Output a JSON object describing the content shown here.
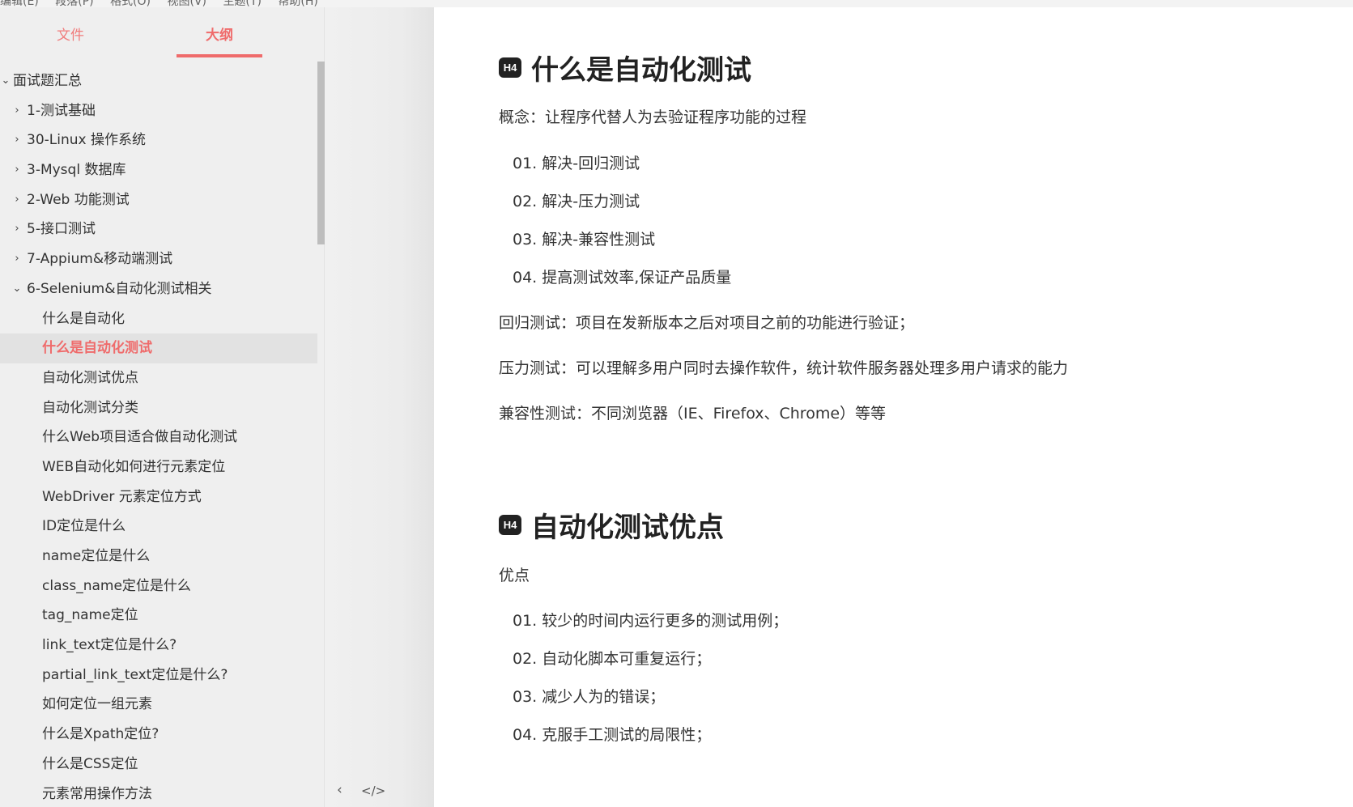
{
  "menubar": {
    "items": [
      "编辑(E)",
      "段落(P)",
      "格式(O)",
      "视图(V)",
      "主题(T)",
      "帮助(H)"
    ]
  },
  "sidebar": {
    "tabs": [
      {
        "label": "文件",
        "active": false
      },
      {
        "label": "大纲",
        "active": true
      }
    ],
    "outline": [
      {
        "label": "面试题汇总",
        "level": 0,
        "expanded": true
      },
      {
        "label": "1-测试基础",
        "level": 1,
        "expanded": false
      },
      {
        "label": "30-Linux 操作系统",
        "level": 1,
        "expanded": false
      },
      {
        "label": "3-Mysql 数据库",
        "level": 1,
        "expanded": false
      },
      {
        "label": "2-Web 功能测试",
        "level": 1,
        "expanded": false
      },
      {
        "label": "5-接口测试",
        "level": 1,
        "expanded": false
      },
      {
        "label": "7-Appium&移动端测试",
        "level": 1,
        "expanded": false
      },
      {
        "label": "6-Selenium&自动化测试相关",
        "level": 1,
        "expanded": true
      },
      {
        "label": "什么是自动化",
        "level": 2
      },
      {
        "label": "什么是自动化测试",
        "level": 2,
        "active": true
      },
      {
        "label": "自动化测试优点",
        "level": 2
      },
      {
        "label": "自动化测试分类",
        "level": 2
      },
      {
        "label": "什么Web项目适合做自动化测试",
        "level": 2
      },
      {
        "label": "WEB自动化如何进行元素定位",
        "level": 2
      },
      {
        "label": "WebDriver 元素定位方式",
        "level": 2
      },
      {
        "label": "ID定位是什么",
        "level": 2
      },
      {
        "label": "name定位是什么",
        "level": 2
      },
      {
        "label": "class_name定位是什么",
        "level": 2
      },
      {
        "label": "tag_name定位",
        "level": 2
      },
      {
        "label": "link_text定位是什么?",
        "level": 2
      },
      {
        "label": "partial_link_text定位是什么?",
        "level": 2
      },
      {
        "label": "如何定位一组元素",
        "level": 2
      },
      {
        "label": "什么是Xpath定位?",
        "level": 2
      },
      {
        "label": "什么是CSS定位",
        "level": 2
      },
      {
        "label": "元素常用操作方法",
        "level": 2
      }
    ],
    "footer": {
      "back_icon": "‹",
      "source_icon": "</>"
    }
  },
  "document": {
    "section1": {
      "badge": "H4",
      "title": "什么是自动化测试",
      "concept": "概念：让程序代替人为去验证程序功能的过程",
      "list": [
        "01. 解决-回归测试",
        "02. 解决-压力测试",
        "03. 解决-兼容性测试",
        "04. 提高测试效率,保证产品质量"
      ],
      "regression": "回归测试：项目在发新版本之后对项目之前的功能进行验证；",
      "stress": "压力测试：可以理解多用户同时去操作软件，统计软件服务器处理多用户请求的能力",
      "compat": "兼容性测试：不同浏览器（IE、Firefox、Chrome）等等"
    },
    "section2": {
      "badge": "H4",
      "title": "自动化测试优点",
      "intro": "优点",
      "list": [
        "01. 较少的时间内运行更多的测试用例；",
        "02. 自动化脚本可重复运行；",
        "03. 减少人为的错误；",
        "04. 克服手工测试的局限性；"
      ]
    }
  },
  "colors": {
    "accent": "#ef6b6b",
    "sidebar_bg": "#efefef",
    "active_row": "#e2e2e2"
  }
}
